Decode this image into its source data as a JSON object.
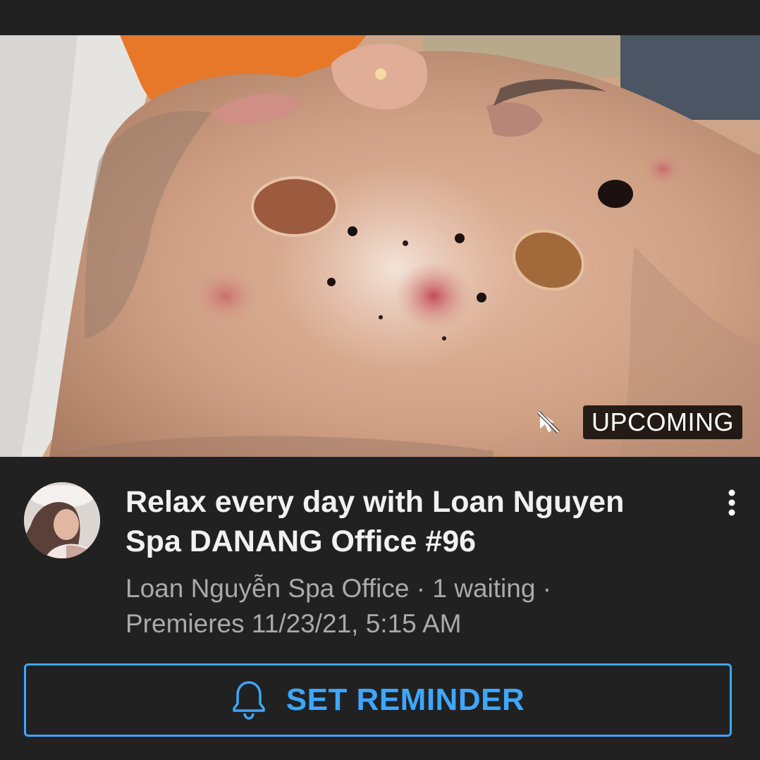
{
  "video": {
    "badge": "UPCOMING",
    "title": "Relax every day with Loan Nguyen Spa DANANG Office #96",
    "channel": "Loan Nguyễn Spa Office",
    "separator": " · ",
    "waiting": "1 waiting",
    "premiere": "Premieres 11/23/21, 5:15 AM"
  },
  "reminder": {
    "label": "SET REMINDER",
    "icon": "bell-icon"
  },
  "icons": {
    "thumbnail_overlay": "no-cast-icon",
    "more": "more-vert-icon"
  },
  "colors": {
    "background": "#212121",
    "title": "#f1f1f1",
    "meta": "#aaaaaa",
    "accent": "#3ea6ff"
  }
}
